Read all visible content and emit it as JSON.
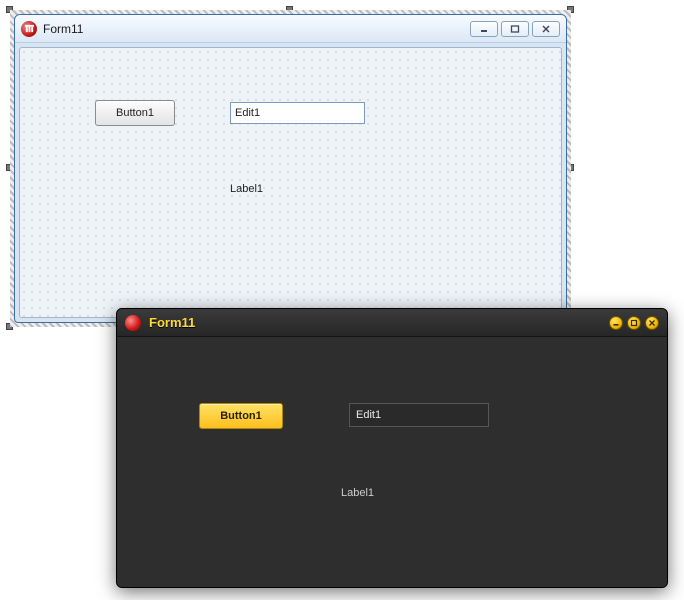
{
  "designer_window": {
    "title": "Form11",
    "icon": "app-icon",
    "controls": {
      "button_label": "Button1",
      "edit_value": "Edit1",
      "label_text": "Label1"
    },
    "window_buttons": {
      "minimize": "minimize-icon",
      "maximize": "maximize-icon",
      "close": "close-icon"
    }
  },
  "runtime_window": {
    "title": "Form11",
    "icon": "app-icon",
    "controls": {
      "button_label": "Button1",
      "edit_value": "Edit1",
      "label_text": "Label1"
    },
    "window_buttons": {
      "minimize": "minimize-icon",
      "maximize": "maximize-icon",
      "close": "close-icon"
    },
    "colors": {
      "accent": "#fdbf1c",
      "title_text": "#ffd83b",
      "background": "#2e2e2e"
    }
  }
}
